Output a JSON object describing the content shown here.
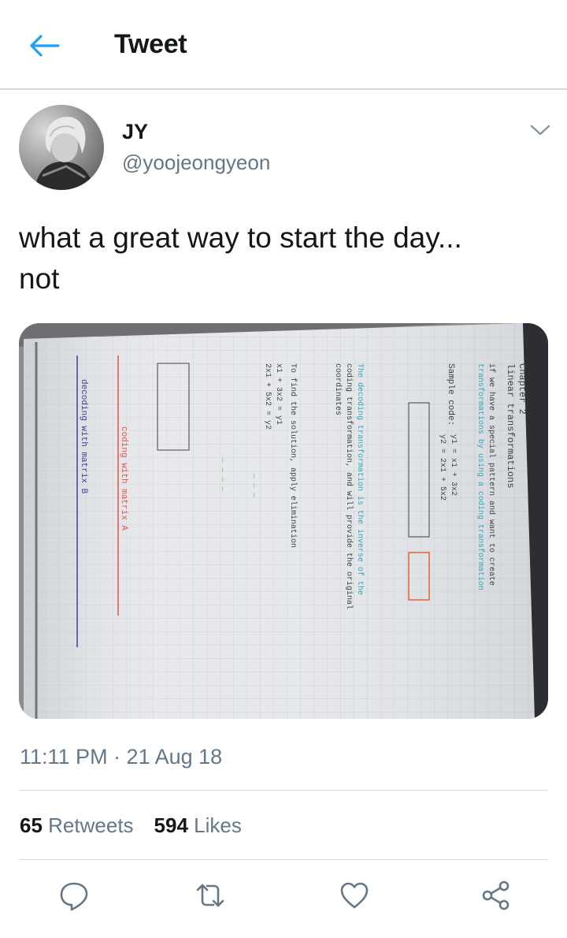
{
  "header": {
    "title": "Tweet"
  },
  "author": {
    "display_name": "JY",
    "handle": "@yoojeongyeon"
  },
  "tweet": {
    "lines": [
      "what a great way to start the day...",
      "not"
    ],
    "timestamp": "11:11 PM · 21 Aug 18"
  },
  "stats": {
    "retweets_count": "65",
    "retweets_label": "Retweets",
    "likes_count": "594",
    "likes_label": "Likes"
  },
  "notes": {
    "chapter": "Chapter 2",
    "chapter_title": "linear transformations",
    "line_1": "if we have a special pattern and want to create",
    "line_2": "transformations by using a coding transformation",
    "sample_code": "Sample code:",
    "eq_1": "y1 = x1 + 3x2",
    "eq_2": "y2 = 2x1 + 5x2",
    "inverse_1": "The decoding transformation is the inverse of the",
    "inverse_2": "coding transformation, and will provide the original",
    "coordinates": "coordinates",
    "solve": "To find the solution, apply elimination",
    "eq_3": "x1 + 3x2 = y1",
    "eq_4": "2x1 + 5x2 = y2",
    "coding_label": "coding with matrix A",
    "decoding_label": "decoding with matrix B"
  },
  "colors": {
    "accent": "#1da1f2",
    "icon_gray": "#657786",
    "text_primary": "#14171a",
    "text_secondary": "#657786"
  },
  "icons": [
    "back-arrow-icon",
    "chevron-down-icon",
    "reply-icon",
    "retweet-icon",
    "like-icon",
    "share-icon"
  ]
}
